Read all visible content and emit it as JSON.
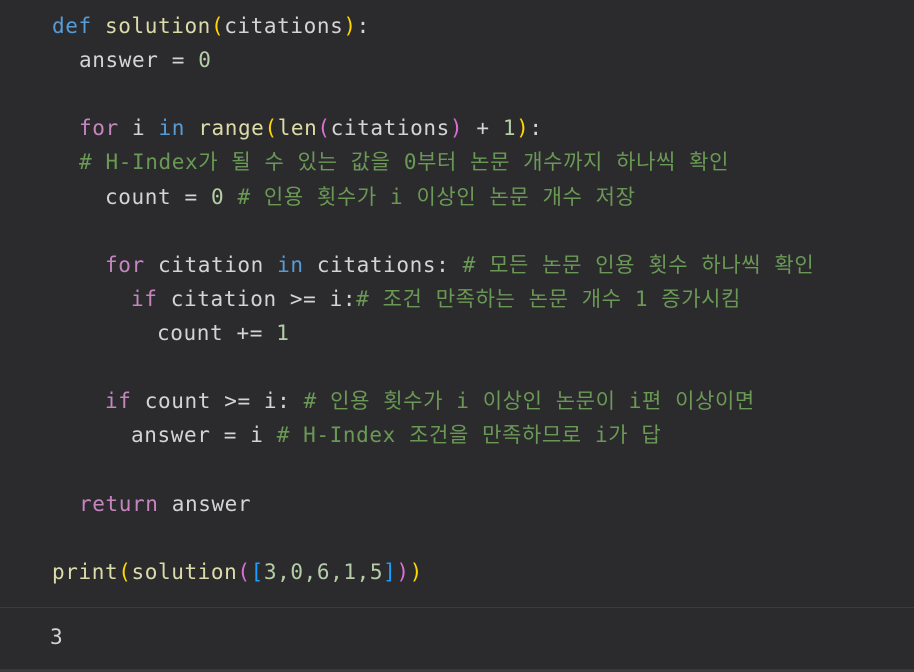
{
  "code": {
    "line1": {
      "kw_def": "def",
      "fn_name": "solution",
      "paren_open": "(",
      "param": "citations",
      "paren_close": ")",
      "colon": ":"
    },
    "line2": {
      "var": "answer",
      "op": " = ",
      "num": "0"
    },
    "line4": {
      "kw_for": "for",
      "var_i": " i ",
      "kw_in": "in",
      "fn_range": " range",
      "p_open": "(",
      "fn_len": "len",
      "p2_open": "(",
      "arg": "citations",
      "p2_close": ")",
      "op": " + ",
      "num": "1",
      "p_close": ")",
      "colon": ":"
    },
    "line5": {
      "comment": "# H-Index가 될 수 있는 값을 0부터 논문 개수까지 하나씩 확인"
    },
    "line6": {
      "var": "count",
      "op": " = ",
      "num": "0",
      "comment": " # 인용 횟수가 i 이상인 논문 개수 저장"
    },
    "line8": {
      "kw_for": "for",
      "var": " citation ",
      "kw_in": "in",
      "iter": " citations",
      "colon": ":",
      "comment": " # 모든 논문 인용 횟수 하나씩 확인"
    },
    "line9": {
      "kw_if": "if",
      "expr": " citation >= i:",
      "comment": "# 조건 만족하는 논문 개수 1 증가시킴"
    },
    "line10": {
      "var": "count",
      "op": " += ",
      "num": "1"
    },
    "line12": {
      "kw_if": "if",
      "expr": " count >= i:",
      "comment": " # 인용 횟수가 i 이상인 논문이 i편 이상이면"
    },
    "line13": {
      "var": "answer",
      "op": " = ",
      "var_i": "i",
      "comment": " # H-Index 조건을 만족하므로 i가 답"
    },
    "line15": {
      "kw_return": "return",
      "var": " answer"
    },
    "line17": {
      "fn_print": "print",
      "p1_open": "(",
      "fn_solution": "solution",
      "p2_open": "(",
      "b_open": "[",
      "list": "3,0,6,1,5",
      "b_close": "]",
      "p2_close": ")",
      "p1_close": ")"
    }
  },
  "output": {
    "text": "3"
  }
}
